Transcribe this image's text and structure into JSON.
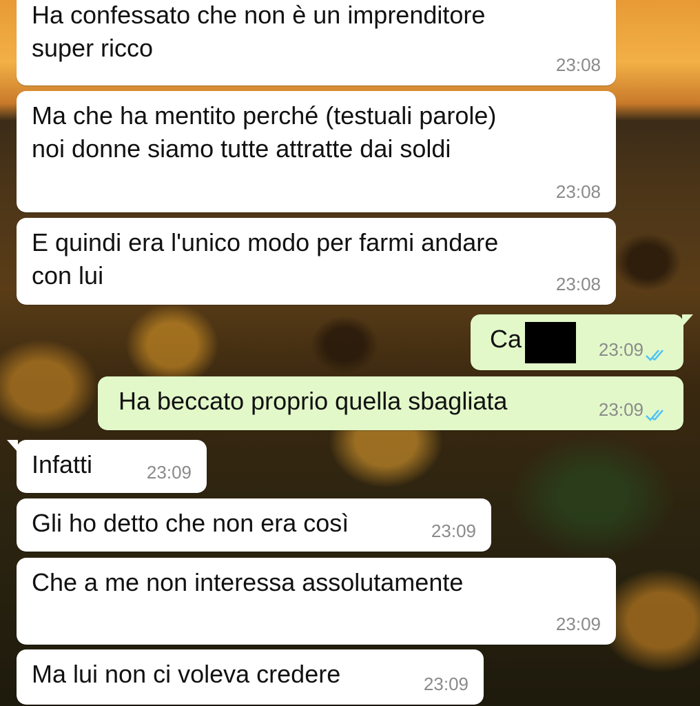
{
  "messages": [
    {
      "text": "Ha confessato che non è un imprenditore\nsuper ricco",
      "time": "23:08"
    },
    {
      "text": "Ma che ha mentito perché (testuali parole)\nnoi donne siamo tutte attratte dai soldi",
      "time": "23:08"
    },
    {
      "text": "E quindi era l'unico modo per farmi andare\ncon lui",
      "time": "23:08"
    },
    {
      "text": "Ca",
      "time": "23:09"
    },
    {
      "text": "Ha beccato proprio quella sbagliata",
      "time": "23:09"
    },
    {
      "text": "Infatti",
      "time": "23:09"
    },
    {
      "text": "Gli ho detto che non era così",
      "time": "23:09"
    },
    {
      "text": "Che a me non interessa assolutamente",
      "time": "23:09"
    },
    {
      "text": "Ma lui non ci voleva credere",
      "time": "23:09"
    }
  ],
  "colors": {
    "incoming_bubble": "#ffffff",
    "outgoing_bubble": "#e2f8c9",
    "read_ticks": "#4fc3f7",
    "timestamp": "#8a8a8a"
  },
  "icons": {
    "read_receipt": "double-check-icon"
  }
}
